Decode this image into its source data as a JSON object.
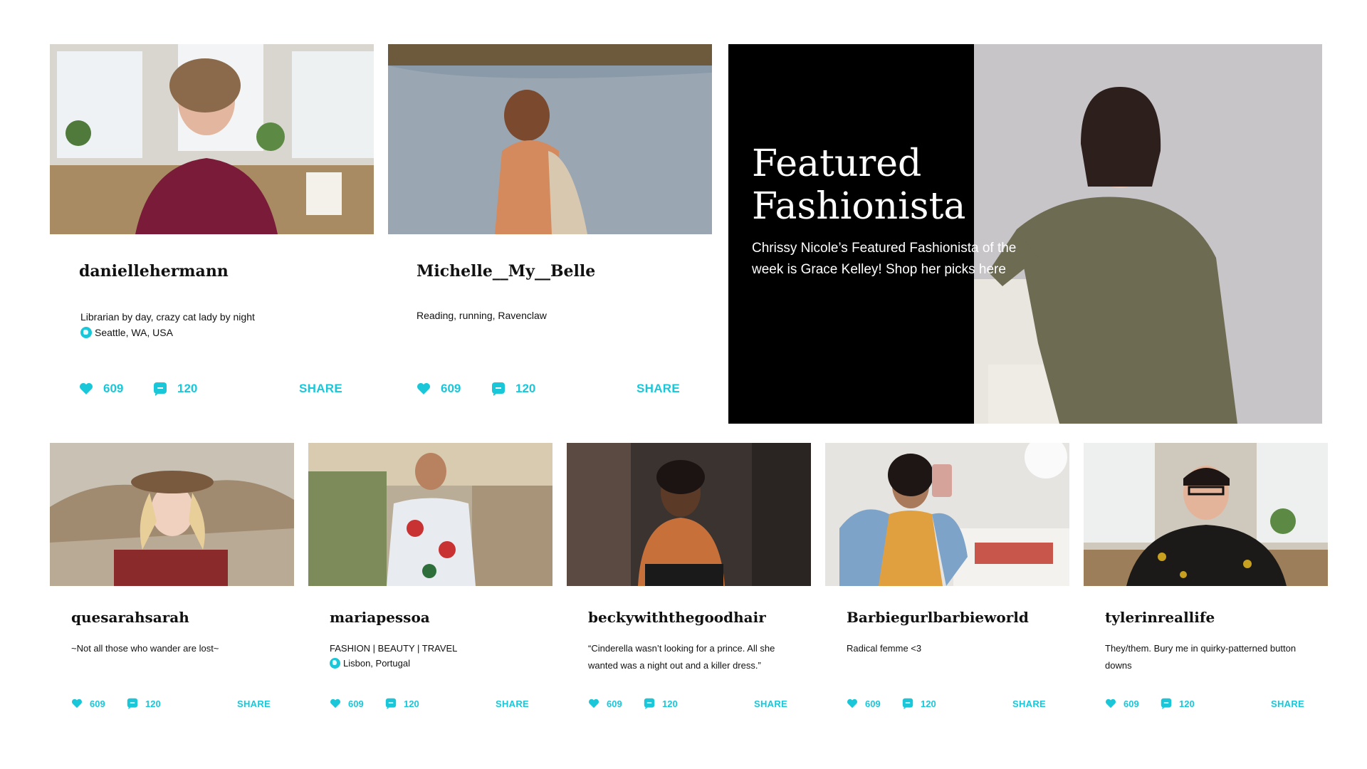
{
  "colors": {
    "accent": "#19c7d9",
    "featured_bg": "#000000"
  },
  "icons": {
    "like": "heart-icon",
    "comment": "comment-icon",
    "location": "globe-icon"
  },
  "featured": {
    "title": "Featured Fashionista",
    "description": "Chrissy Nicole’s Featured Fashionista of the week is Grace Kelley! Shop her picks here"
  },
  "cards": [
    {
      "username": "daniellehermann",
      "bio": "Librarian by day, crazy cat lady by night",
      "location": "Seattle, WA, USA",
      "likes": "609",
      "comments": "120",
      "share": "SHARE"
    },
    {
      "username": "Michelle__My__Belle",
      "bio": "Reading, running, Ravenclaw",
      "location": "",
      "likes": "609",
      "comments": "120",
      "share": "SHARE"
    },
    {
      "username": "quesarahsarah",
      "bio": "~Not all those who wander are lost~",
      "location": "",
      "likes": "609",
      "comments": "120",
      "share": "SHARE"
    },
    {
      "username": "mariapessoa",
      "bio": "FASHION | BEAUTY | TRAVEL",
      "location": "Lisbon, Portugal",
      "likes": "609",
      "comments": "120",
      "share": "SHARE"
    },
    {
      "username": "beckywiththegoodhair",
      "bio": "“Cinderella wasn’t looking for a prince. All she wanted was a night out and a killer dress.”",
      "location": "",
      "likes": "609",
      "comments": "120",
      "share": "SHARE"
    },
    {
      "username": "Barbiegurlbarbieworld",
      "bio": "Radical femme <3",
      "location": "",
      "likes": "609",
      "comments": "120",
      "share": "SHARE"
    },
    {
      "username": "tylerinreallife",
      "bio": "They/them. Bury me in quirky-patterned button downs",
      "location": "",
      "likes": "609",
      "comments": "120",
      "share": "SHARE"
    }
  ]
}
